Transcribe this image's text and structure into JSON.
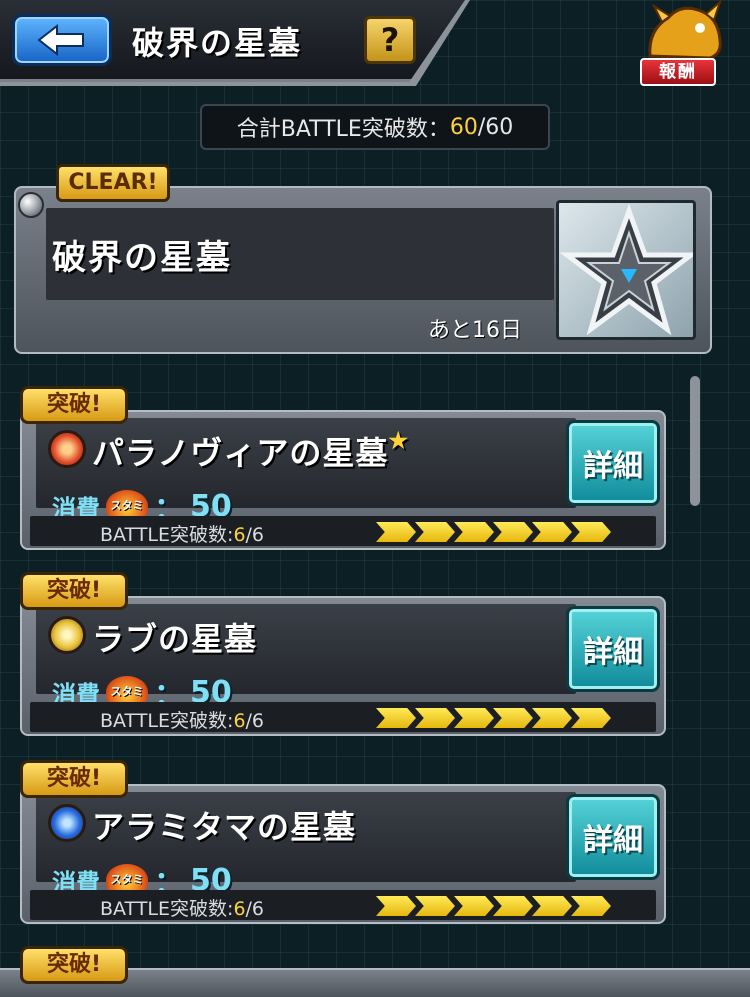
{
  "header": {
    "title": "破界の星墓",
    "help_label": "?",
    "reward_label": "報酬"
  },
  "total": {
    "prefix": "合計BATTLE突破数：",
    "current": "60",
    "separator": "/",
    "max": "60"
  },
  "event": {
    "badge": "CLEAR!",
    "title": "破界の星墓",
    "remaining": "あと16日"
  },
  "stages": [
    {
      "badge": "突破!",
      "name": "パラノヴィアの星墓",
      "star": "★",
      "icon": "fire-element-icon",
      "icon_color": "#e04a2a",
      "cost_label": "消費",
      "stamina_label": "スタミナ",
      "cost_sep": "：",
      "cost_value": "50",
      "progress_prefix": "BATTLE突破数:",
      "progress_current": "6",
      "progress_max": "/6",
      "detail_label": "詳細"
    },
    {
      "badge": "突破!",
      "name": "ラブの星墓",
      "star": "",
      "icon": "light-element-icon",
      "icon_color": "#e8c23a",
      "cost_label": "消費",
      "stamina_label": "スタミナ",
      "cost_sep": "：",
      "cost_value": "50",
      "progress_prefix": "BATTLE突破数:",
      "progress_current": "6",
      "progress_max": "/6",
      "detail_label": "詳細"
    },
    {
      "badge": "突破!",
      "name": "アラミタマの星墓",
      "star": "",
      "icon": "water-element-icon",
      "icon_color": "#2a6ee0",
      "cost_label": "消費",
      "stamina_label": "スタミナ",
      "cost_sep": "：",
      "cost_value": "50",
      "progress_prefix": "BATTLE突破数:",
      "progress_current": "6",
      "progress_max": "/6",
      "detail_label": "詳細"
    }
  ],
  "partial_stage": {
    "badge": "突破!"
  }
}
